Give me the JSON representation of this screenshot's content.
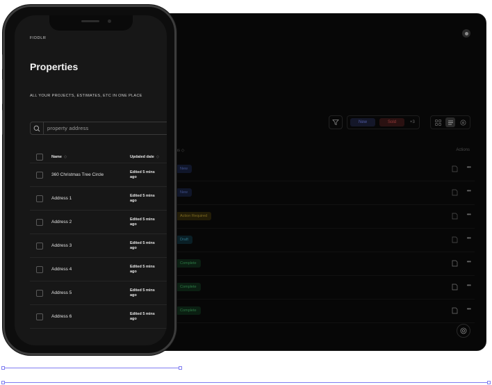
{
  "mobile": {
    "brand": "FIDDLR",
    "title": "Properties",
    "subtitle": "ALL YOUR PROJECTS, ESTIMATES, ETC IN ONE PLACE",
    "search": {
      "placeholder": "property address"
    },
    "table": {
      "headers": {
        "name": "Name",
        "updated": "Updated date"
      },
      "sort_glyph": "◇",
      "rows": [
        {
          "name": "360 Christmas Tree Circle",
          "updated_line1": "Edited 5 mins",
          "updated_line2": "ago"
        },
        {
          "name": "Address 1",
          "updated_line1": "Edited 5 mins",
          "updated_line2": "ago"
        },
        {
          "name": "Address 2",
          "updated_line1": "Edited 5 mins",
          "updated_line2": "ago"
        },
        {
          "name": "Address 3",
          "updated_line1": "Edited 5 mins",
          "updated_line2": "ago"
        },
        {
          "name": "Address 4",
          "updated_line1": "Edited 5 mins",
          "updated_line2": "ago"
        },
        {
          "name": "Address 5",
          "updated_line1": "Edited 5 mins",
          "updated_line2": "ago"
        },
        {
          "name": "Address 6",
          "updated_line1": "Edited 5 mins",
          "updated_line2": "ago"
        }
      ]
    }
  },
  "desktop": {
    "filters": {
      "chip_new": "New",
      "chip_sold": "Sold",
      "more": "+3"
    },
    "table": {
      "status_header": "tus",
      "actions_header": "Actions",
      "statuses": [
        "New",
        "New",
        "Action Required",
        "Draft",
        "Complete",
        "Complete",
        "Complete"
      ]
    },
    "more_glyph": "•••"
  },
  "colors": {
    "accent_guide": "#7f7cf0",
    "status_new": "#3f4f8c",
    "status_action_required": "#7d6a22",
    "status_draft": "#2c7285",
    "status_complete": "#2d7a45"
  }
}
